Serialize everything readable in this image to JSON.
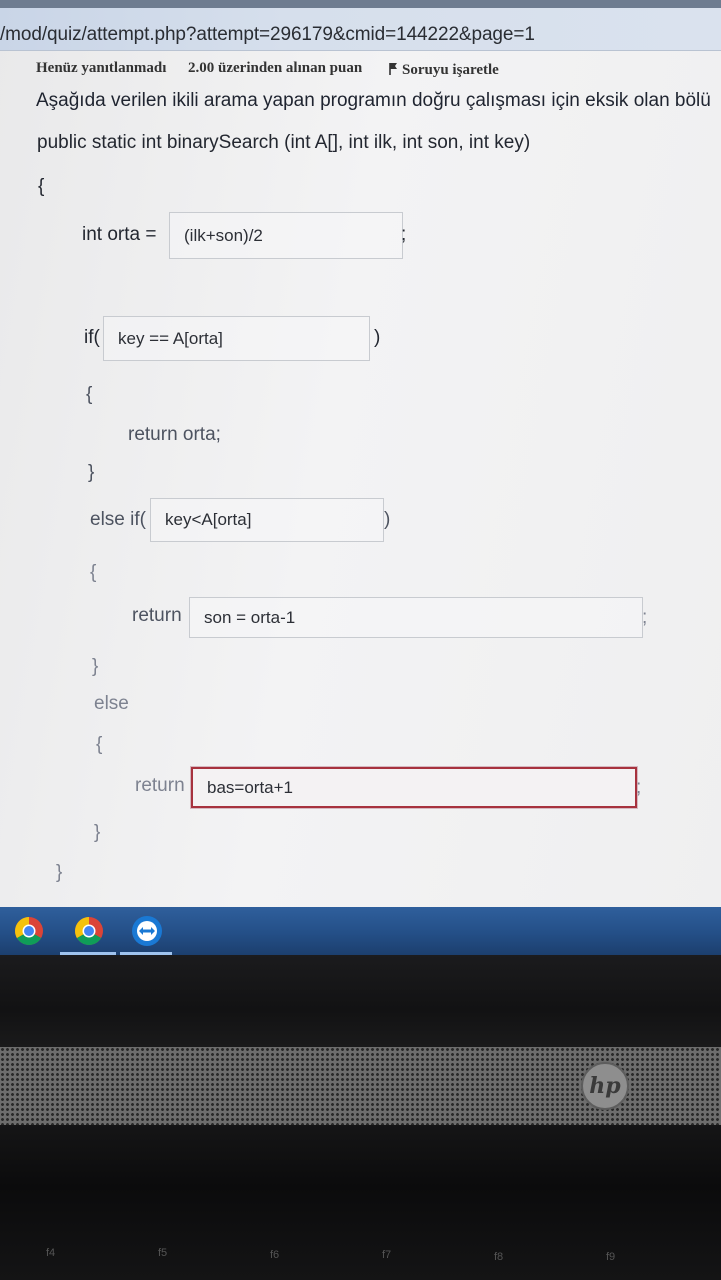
{
  "browser": {
    "url": "/mod/quiz/attempt.php?attempt=296179&cmid=144222&page=1"
  },
  "question_info": {
    "status": "Henüz yanıtlanmadı",
    "grade": "2.00 üzerinden alınan puan",
    "flag_label": "Soruyu işaretle"
  },
  "question": {
    "text": "Aşağıda verilen ikili arama yapan programın doğru çalışması için eksik olan bölü"
  },
  "code": {
    "signature": "public static int binarySearch (int A[], int ilk, int son, int key)",
    "open_brace": "{",
    "close_brace": "}",
    "int_orta_label": "int orta =",
    "semicolon": ";",
    "if_label": "if(",
    "close_paren": ")",
    "return_orta": "return orta;",
    "else_if_label": "else if(",
    "return_label": "return",
    "else_label": "else"
  },
  "answers": {
    "orta_value": "(ilk+son)/2",
    "if_condition": "key == A[orta]",
    "else_if_condition": "key<A[orta]",
    "return1_value": "son = orta-1",
    "return2_value": "bas=orta+1"
  },
  "taskbar": {
    "icons": [
      "chrome-icon",
      "chrome-icon",
      "teamviewer-icon"
    ]
  },
  "laptop": {
    "brand": "hp",
    "fkeys": [
      "f4",
      "f5",
      "f6",
      "f7",
      "f8",
      "f9"
    ]
  }
}
